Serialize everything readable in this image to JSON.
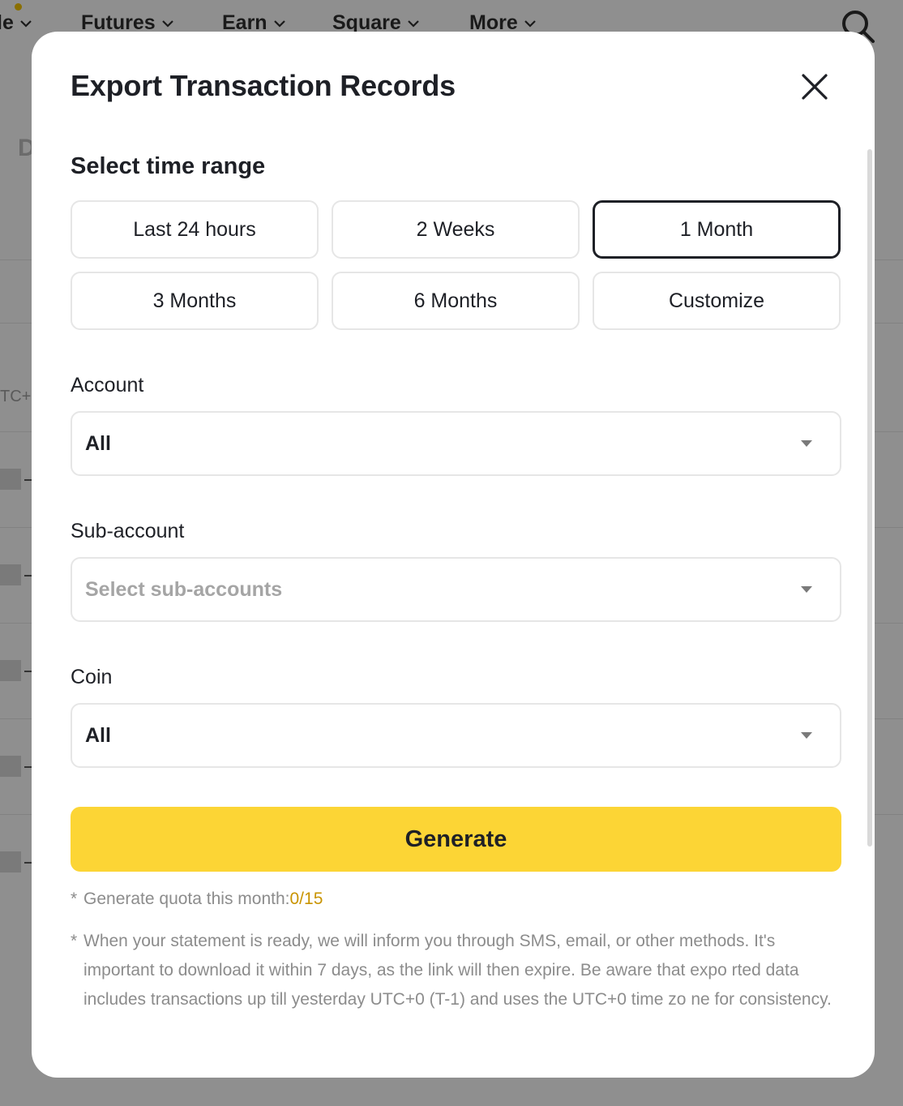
{
  "background": {
    "nav": [
      {
        "label": "le"
      },
      {
        "label": "Futures"
      },
      {
        "label": "Earn"
      },
      {
        "label": "Square"
      },
      {
        "label": "More"
      }
    ],
    "partial_heading": "D",
    "partial_utc": "TC+"
  },
  "modal": {
    "title": "Export Transaction Records",
    "time_range": {
      "title": "Select time range",
      "options": [
        "Last 24 hours",
        "2 Weeks",
        "1 Month",
        "3 Months",
        "6 Months",
        "Customize"
      ],
      "selected": "1 Month"
    },
    "account": {
      "label": "Account",
      "value": "All"
    },
    "sub_account": {
      "label": "Sub-account",
      "placeholder": "Select sub-accounts"
    },
    "coin": {
      "label": "Coin",
      "value": "All"
    },
    "generate_label": "Generate",
    "notes": {
      "star": "*",
      "quota_text": "Generate quota this month:",
      "quota_value": "0/15",
      "info_text": "When your statement is ready, we will inform you through SMS, email, or other methods. It's important to download it within 7 days, as the link will then expire. Be aware that expo rted data includes transactions up till yesterday UTC+0 (T-1) and uses the UTC+0 time zo ne for consistency."
    }
  },
  "colors": {
    "accent": "#fcd535",
    "quota": "#c99400",
    "overlay": "#8f8f8f"
  }
}
